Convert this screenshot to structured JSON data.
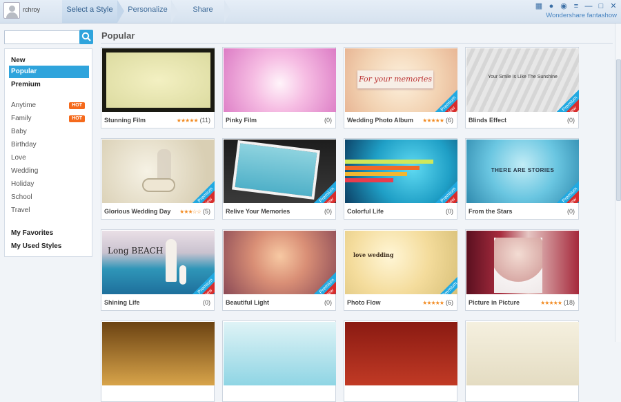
{
  "header": {
    "username": "rchroy",
    "steps": [
      "Select a Style",
      "Personalize",
      "Share"
    ],
    "brand": "Wondershare fantashow"
  },
  "search": {
    "placeholder": ""
  },
  "sidebar": {
    "items": [
      {
        "label": "New"
      },
      {
        "label": "Popular"
      },
      {
        "label": "Premium"
      },
      {
        "label": "Anytime",
        "badge": "HOT"
      },
      {
        "label": "Family",
        "badge": "HOT"
      },
      {
        "label": "Baby"
      },
      {
        "label": "Birthday"
      },
      {
        "label": "Love"
      },
      {
        "label": "Wedding"
      },
      {
        "label": "Holiday"
      },
      {
        "label": "School"
      },
      {
        "label": "Travel"
      },
      {
        "label": "My Favorites"
      },
      {
        "label": "My Used Styles"
      }
    ]
  },
  "main": {
    "section_title": "Popular",
    "cards": [
      {
        "title": "Stunning Film",
        "stars": "★★★★★",
        "count": "(11)",
        "premium": false
      },
      {
        "title": "Pinky Film",
        "stars": "",
        "count": "(0)",
        "premium": false
      },
      {
        "title": "Wedding Photo Album",
        "stars": "★★★★★",
        "count": "(6)",
        "premium": true,
        "overlay": "For your memories"
      },
      {
        "title": "Blinds Effect",
        "stars": "",
        "count": "(0)",
        "premium": true,
        "overlay": "Your Smile Is Like The Sunshine"
      },
      {
        "title": "Glorious Wedding Day",
        "stars": "★★★☆☆",
        "count": "(5)",
        "premium": true
      },
      {
        "title": "Relive Your Memories",
        "stars": "",
        "count": "(0)",
        "premium": true
      },
      {
        "title": "Colorful Life",
        "stars": "",
        "count": "(0)",
        "premium": true
      },
      {
        "title": "From the Stars",
        "stars": "",
        "count": "(0)",
        "premium": true,
        "overlay": "THERE ARE STORIES"
      },
      {
        "title": "Shining Life",
        "stars": "",
        "count": "(0)",
        "premium": true,
        "overlay": "Long BEACH"
      },
      {
        "title": "Beautiful Light",
        "stars": "",
        "count": "(0)",
        "premium": true
      },
      {
        "title": "Photo Flow",
        "stars": "★★★★★",
        "count": "(6)",
        "premium": true,
        "overlay": "love wedding"
      },
      {
        "title": "Picture in Picture",
        "stars": "★★★★★",
        "count": "(18)",
        "premium": false
      }
    ],
    "ribbon": {
      "premium": "Premium",
      "new": "New"
    }
  },
  "colors": {
    "accent": "#2fa4dc",
    "hot": "#f56a1c",
    "star": "#f28b22",
    "ribbon_new": "#d82c2c"
  }
}
